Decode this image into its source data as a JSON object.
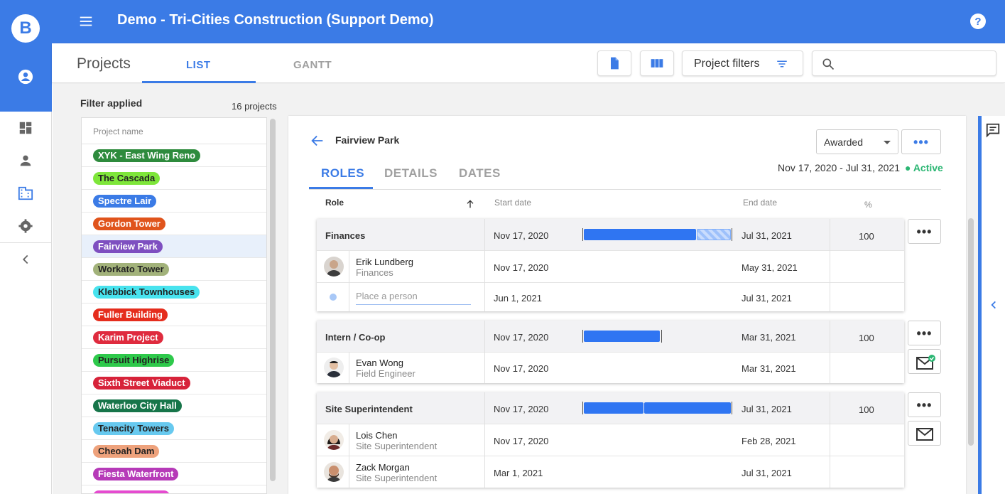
{
  "app": {
    "title": "Demo - Tri-Cities Construction (Support Demo)",
    "logo_letter": "B",
    "accent": "#3b7be6"
  },
  "rail": {
    "icons": [
      "account-icon",
      "dashboard-icon",
      "person-icon",
      "business-icon",
      "settings-icon",
      "collapse-chevron-icon"
    ]
  },
  "subheader": {
    "title": "Projects",
    "tabs": [
      "LIST",
      "GANTT"
    ],
    "active_tab": "LIST",
    "filter_button": "Project filters",
    "search_placeholder": ""
  },
  "list": {
    "filter_label": "Filter applied",
    "count": "16 projects",
    "column": "Project name",
    "projects": [
      {
        "name": "XYK - East Wing Reno",
        "color": "#2e8b3d",
        "dark": false
      },
      {
        "name": "The Cascada",
        "color": "#7ee63a",
        "dark": true
      },
      {
        "name": "Spectre Lair",
        "color": "#3b7be6",
        "dark": false
      },
      {
        "name": "Gordon Tower",
        "color": "#e0541c",
        "dark": false
      },
      {
        "name": "Fairview Park",
        "color": "#7e4fc0",
        "dark": false
      },
      {
        "name": "Workato Tower",
        "color": "#a2b27a",
        "dark": true
      },
      {
        "name": "Klebbick Townhouses",
        "color": "#48e3ee",
        "dark": true
      },
      {
        "name": "Fuller Building",
        "color": "#e52d1d",
        "dark": false
      },
      {
        "name": "Karim Project",
        "color": "#df2b3e",
        "dark": false
      },
      {
        "name": "Pursuit Highrise",
        "color": "#2ec94b",
        "dark": true
      },
      {
        "name": "Sixth Street Viaduct",
        "color": "#d7233a",
        "dark": false
      },
      {
        "name": "Waterloo City Hall",
        "color": "#17754a",
        "dark": false
      },
      {
        "name": "Tenacity Towers",
        "color": "#67c9ef",
        "dark": true
      },
      {
        "name": "Cheoah Dam",
        "color": "#eea27c",
        "dark": true
      },
      {
        "name": "Fiesta Waterfront",
        "color": "#b63ab8",
        "dark": false
      },
      {
        "name": "",
        "color": "#e54bd0",
        "dark": false
      }
    ],
    "selected": "Fairview Park"
  },
  "detail": {
    "project": "Fairview Park",
    "status": "Awarded",
    "tabs": [
      "ROLES",
      "DETAILS",
      "DATES"
    ],
    "active_tab": "ROLES",
    "date_range": "Nov 17, 2020 - Jul 31, 2021",
    "state": "● Active",
    "columns": {
      "role": "Role",
      "start": "Start date",
      "end": "End date",
      "pct": "%"
    },
    "groups": [
      {
        "role": "Finances",
        "start": "Nov 17, 2020",
        "end": "Jul 31, 2021",
        "pct": "100",
        "people": [
          {
            "name": "Erik Lundberg",
            "title": "Finances",
            "start": "Nov 17, 2020",
            "end": "May 31, 2021"
          },
          {
            "name": "",
            "title": "",
            "placeholder": "Place a person",
            "start": "Jun 1, 2021",
            "end": "Jul 31, 2021"
          }
        ]
      },
      {
        "role": "Intern / Co-op",
        "start": "Nov 17, 2020",
        "end": "Mar 31, 2021",
        "pct": "100",
        "people": [
          {
            "name": "Evan Wong",
            "title": "Field Engineer",
            "start": "Nov 17, 2020",
            "end": "Mar 31, 2021"
          }
        ]
      },
      {
        "role": "Site Superintendent",
        "start": "Nov 17, 2020",
        "end": "Jul 31, 2021",
        "pct": "100",
        "people": [
          {
            "name": "Lois Chen",
            "title": "Site Superintendent",
            "start": "Nov 17, 2020",
            "end": "Feb 28, 2021"
          },
          {
            "name": "Zack Morgan",
            "title": "Site Superintendent",
            "start": "Mar 1, 2021",
            "end": "Jul 31, 2021"
          }
        ]
      }
    ]
  }
}
